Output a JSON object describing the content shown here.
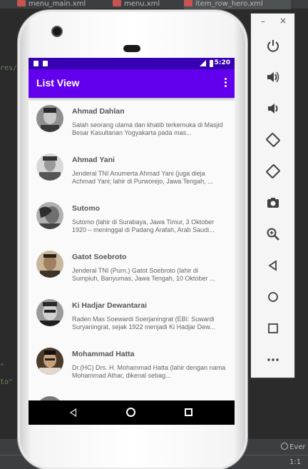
{
  "ide": {
    "tabs": [
      {
        "label": "menu_main.xml"
      },
      {
        "label": "menu.xml"
      },
      {
        "label": "item_row_hero.xml"
      }
    ],
    "code_fragments": [
      "res/",
      "\"",
      "to\""
    ],
    "status_event": "Ever",
    "status_position": "1:1"
  },
  "device": {
    "status_bar": {
      "time": "5:20"
    },
    "app_bar": {
      "title": "List View"
    },
    "heroes": [
      {
        "name": "Ahmad Dahlan",
        "description": "Salah seorang ulama dan khatib terkemuka di Masjid Besar Kasultanan Yogyakarta pada mas..."
      },
      {
        "name": "Ahmad Yani",
        "description": "Jenderal TNI Anumerta Ahmad Yani (juga dieja Achmad Yani; lahir di Purworejo, Jawa Tengah, ..."
      },
      {
        "name": "Sutomo",
        "description": "Sutomo (lahir di Surabaya, Jawa Timur, 3 Oktober 1920 – meninggal di Padang Arafah, Arab Saudi..."
      },
      {
        "name": "Gatot Soebroto",
        "description": "Jenderal TNI (Purn.) Gatot Soebroto (lahir di Sumpiuh, Banyumas, Jawa Tengah, 10 Oktober ..."
      },
      {
        "name": "Ki Hadjar Dewantarai",
        "description": "Raden Mas Soewardi Soerjaningrat (EBI: Suwardi Suryaningrat, sejak 1922 menjadi Ki Hadjar Dew..."
      },
      {
        "name": "Mohammad Hatta",
        "description": "Dr.(HC) Drs. H. Mohammad Hatta (lahir dengan nama Mohammad Athar, dikenal sebag..."
      },
      {
        "name": "",
        "description": ""
      }
    ]
  },
  "emulator_panel": {
    "minimize": "–",
    "close": "×",
    "buttons": [
      {
        "icon": "power-icon",
        "glyph": "⏻"
      },
      {
        "icon": "volume-up-icon",
        "glyph": "🔊"
      },
      {
        "icon": "volume-down-icon",
        "glyph": "🔉"
      },
      {
        "icon": "rotate-left-icon",
        "glyph": "⟲"
      },
      {
        "icon": "rotate-right-icon",
        "glyph": "⟳"
      },
      {
        "icon": "camera-icon",
        "glyph": "📷"
      },
      {
        "icon": "zoom-icon",
        "glyph": "🔍"
      },
      {
        "icon": "back-icon",
        "glyph": "◁"
      },
      {
        "icon": "home-icon",
        "glyph": "○"
      },
      {
        "icon": "overview-icon",
        "glyph": "□"
      },
      {
        "icon": "more-icon",
        "glyph": "•••"
      }
    ]
  },
  "colors": {
    "status_bar": "#3700b3",
    "app_bar": "#6200ee",
    "list_background": "#fafafa"
  }
}
